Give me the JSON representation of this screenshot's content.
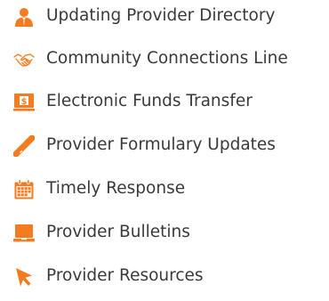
{
  "colors": {
    "accent": "#F47B20",
    "text": "#3A3A3A"
  },
  "links": [
    {
      "label": "Updating Provider Directory",
      "icon": "person-icon"
    },
    {
      "label": "Community Connections Line",
      "icon": "handshake-icon"
    },
    {
      "label": "Electronic Funds Transfer",
      "icon": "dollar-monitor-icon"
    },
    {
      "label": "Provider Formulary Updates",
      "icon": "pill-icon"
    },
    {
      "label": "Timely Response",
      "icon": "calendar-icon"
    },
    {
      "label": "Provider Bulletins",
      "icon": "laptop-icon"
    },
    {
      "label": "Provider Resources",
      "icon": "cursor-arrow-icon"
    }
  ]
}
